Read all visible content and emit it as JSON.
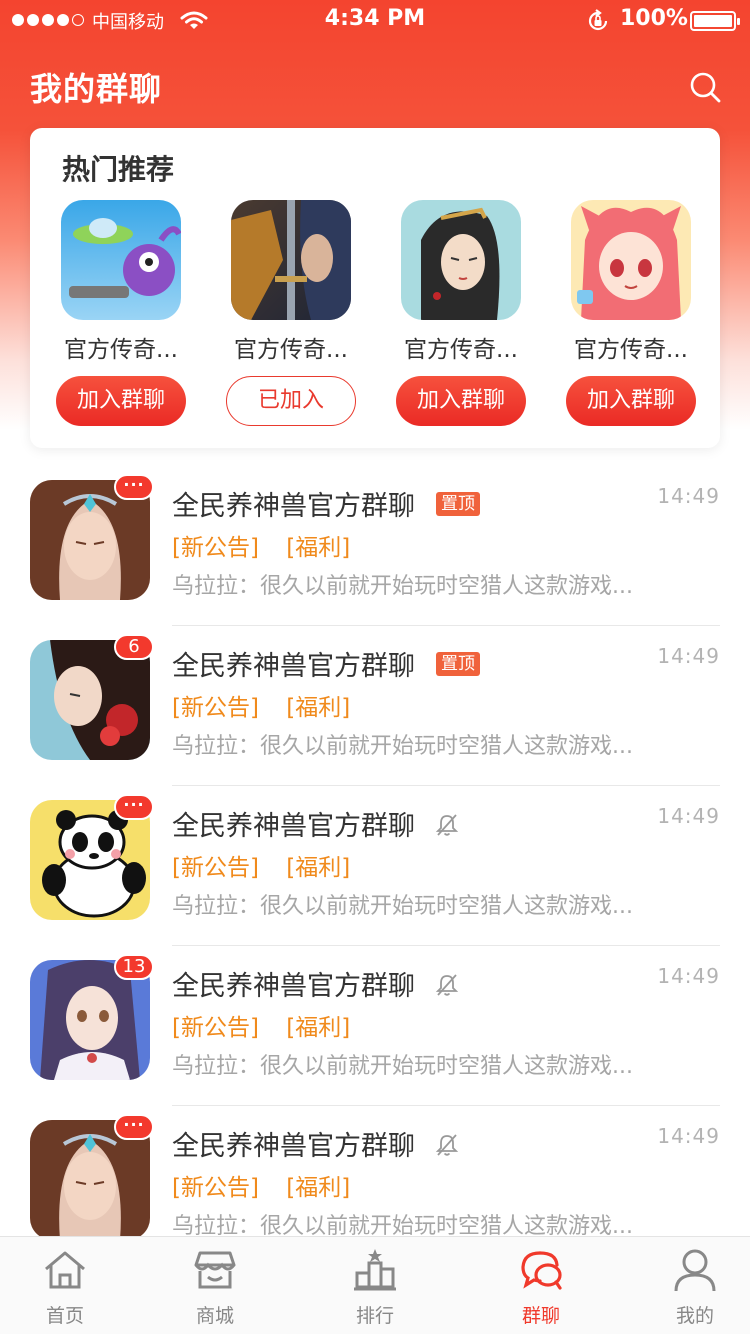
{
  "status_bar": {
    "carrier": "中国移动",
    "time": "4:34 PM",
    "battery": "100%"
  },
  "header": {
    "title": "我的群聊"
  },
  "hot": {
    "title": "热门推荐",
    "items": [
      {
        "name": "官方传奇...",
        "button": "加入群聊"
      },
      {
        "name": "官方传奇...",
        "button": "已加入"
      },
      {
        "name": "官方传奇...",
        "button": "加入群聊"
      },
      {
        "name": "官方传奇...",
        "button": "加入群聊"
      }
    ]
  },
  "chats": [
    {
      "name": "全民养神兽官方群聊",
      "tag": "置顶",
      "time": "14:49",
      "notice": "[新公告]",
      "welfare": "[福利]",
      "preview": "乌拉拉：很久以前就开始玩时空猎人这款游戏...",
      "badge": "···"
    },
    {
      "name": "全民养神兽官方群聊",
      "tag": "置顶",
      "time": "14:49",
      "notice": "[新公告]",
      "welfare": "[福利]",
      "preview": "乌拉拉：很久以前就开始玩时空猎人这款游戏...",
      "badge": "6"
    },
    {
      "name": "全民养神兽官方群聊",
      "tag": "",
      "time": "14:49",
      "notice": "[新公告]",
      "welfare": "[福利]",
      "preview": "乌拉拉：很久以前就开始玩时空猎人这款游戏...",
      "badge": "···"
    },
    {
      "name": "全民养神兽官方群聊",
      "tag": "",
      "time": "14:49",
      "notice": "[新公告]",
      "welfare": "[福利]",
      "preview": "乌拉拉：很久以前就开始玩时空猎人这款游戏...",
      "badge": "13"
    },
    {
      "name": "全民养神兽官方群聊",
      "tag": "",
      "time": "14:49",
      "notice": "[新公告]",
      "welfare": "[福利]",
      "preview": "乌拉拉：很久以前就开始玩时空猎人这款游戏...",
      "badge": "···"
    }
  ],
  "tabs": [
    {
      "label": "首页",
      "icon": "home-icon"
    },
    {
      "label": "商城",
      "icon": "store-icon"
    },
    {
      "label": "排行",
      "icon": "ranking-icon"
    },
    {
      "label": "群聊",
      "icon": "group-chat-icon",
      "active": true
    },
    {
      "label": "我的",
      "icon": "profile-icon"
    }
  ],
  "colors": {
    "brand_red": "#f4442f",
    "tag_orange": "#f08a1c",
    "active_tab": "#f0392b"
  }
}
